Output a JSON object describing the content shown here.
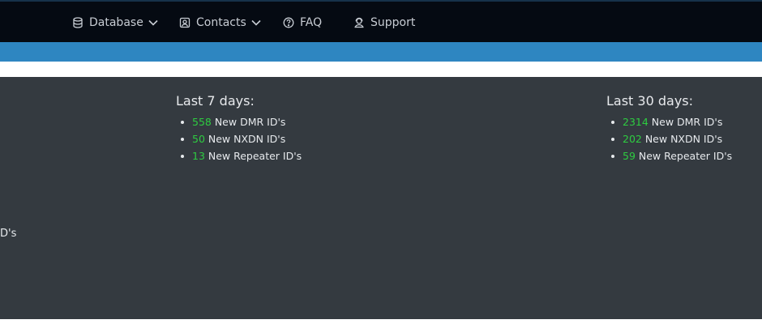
{
  "nav": {
    "items": [
      {
        "label": "Database",
        "icon": "database-icon",
        "dropdown": true
      },
      {
        "label": "Contacts",
        "icon": "contacts-icon",
        "dropdown": true
      },
      {
        "label": "FAQ",
        "icon": "help-circle-icon",
        "dropdown": false
      },
      {
        "label": "Support",
        "icon": "support-icon",
        "dropdown": false
      }
    ]
  },
  "colors": {
    "navbar_bg": "#050a12",
    "accent_bar": "#2e86c1",
    "content_bg": "#343a40",
    "number_green": "#2ecc40"
  },
  "stats": {
    "week": {
      "title": "Last 7 days:",
      "items": [
        {
          "count": "558",
          "label": " New DMR ID's"
        },
        {
          "count": "50",
          "label": " New NXDN ID's"
        },
        {
          "count": "13",
          "label": " New Repeater ID's"
        }
      ]
    },
    "month": {
      "title": "Last 30 days:",
      "items": [
        {
          "count": "2314",
          "label": " New DMR ID's"
        },
        {
          "count": "202",
          "label": " New NXDN ID's"
        },
        {
          "count": "59",
          "label": " New Repeater ID's"
        }
      ]
    }
  },
  "clipped": {
    "text": "D's"
  }
}
